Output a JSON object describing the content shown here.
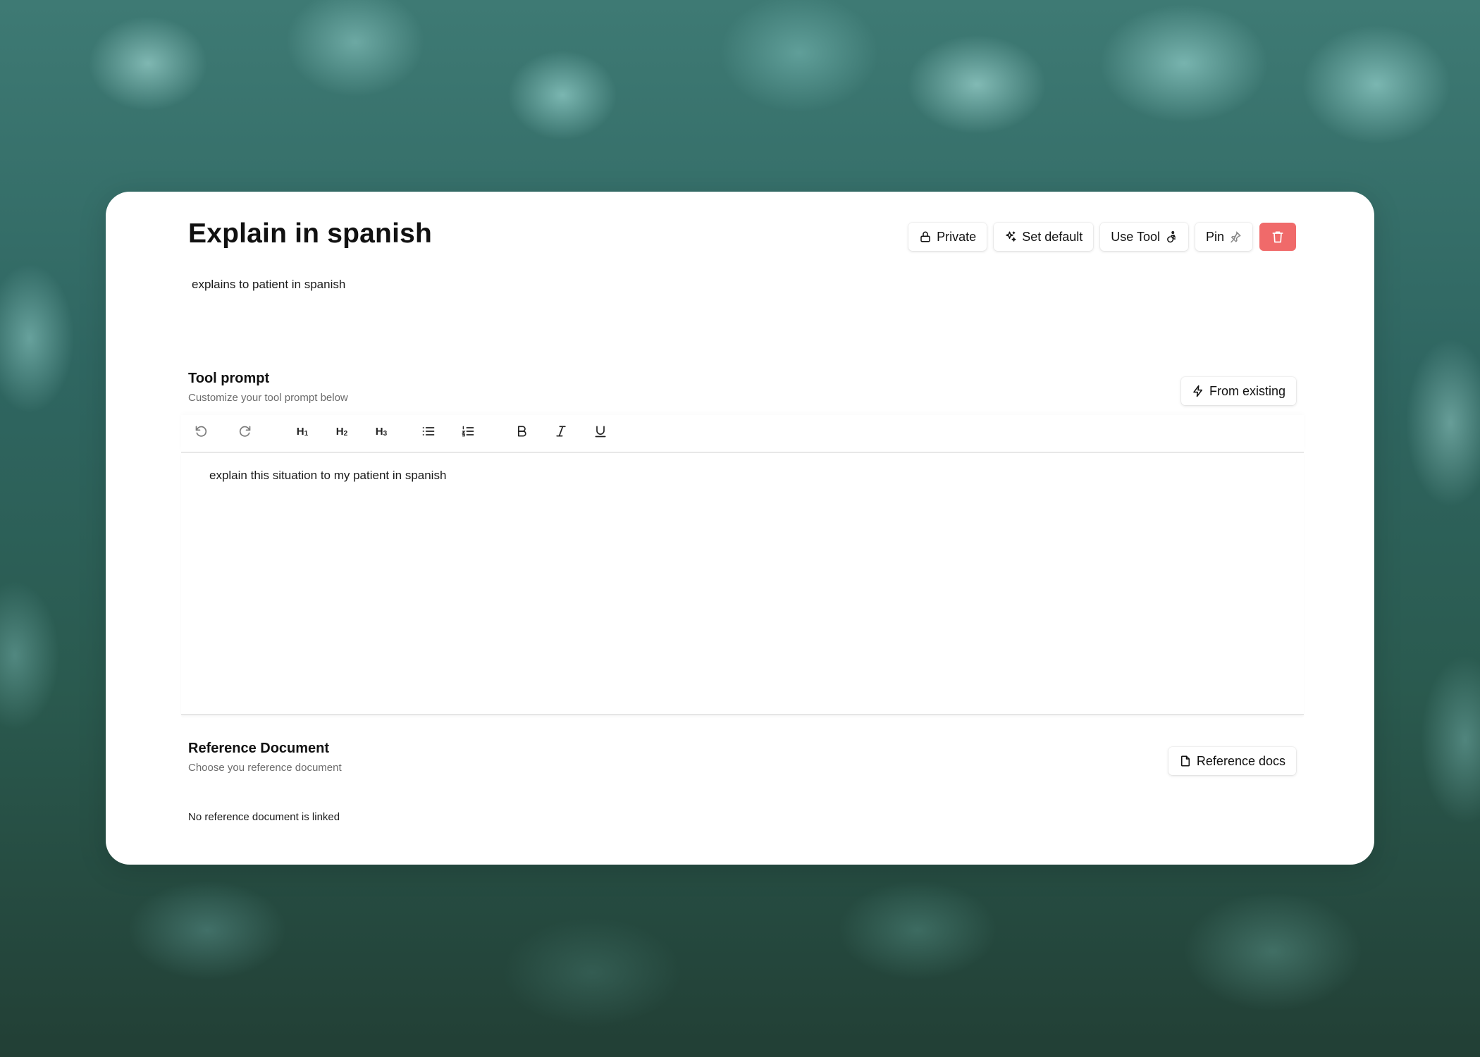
{
  "tool": {
    "title": "Explain in spanish",
    "description": "explains to patient in spanish"
  },
  "actions": {
    "private_label": "Private",
    "set_default_label": "Set default",
    "use_tool_label": "Use Tool",
    "pin_label": "Pin",
    "delete_color": "#f06a6a"
  },
  "prompt_section": {
    "title": "Tool prompt",
    "subtitle": "Customize your tool prompt below",
    "from_existing_label": "From existing",
    "toolbar": {
      "h1_label": "H",
      "h1_sub": "1",
      "h2_label": "H",
      "h2_sub": "2",
      "h3_label": "H",
      "h3_sub": "3"
    },
    "content": "explain this situation to my patient in spanish"
  },
  "reference_section": {
    "title": "Reference Document",
    "subtitle": "Choose you reference document",
    "button_label": "Reference docs",
    "empty_text": "No reference document is linked"
  },
  "icons": {
    "private": "lock-icon",
    "set_default": "sparkles-icon",
    "use_tool": "accessibility-icon",
    "pin": "pin-icon",
    "delete": "trash-icon",
    "from_existing": "zap-icon",
    "reference_docs": "file-icon"
  }
}
